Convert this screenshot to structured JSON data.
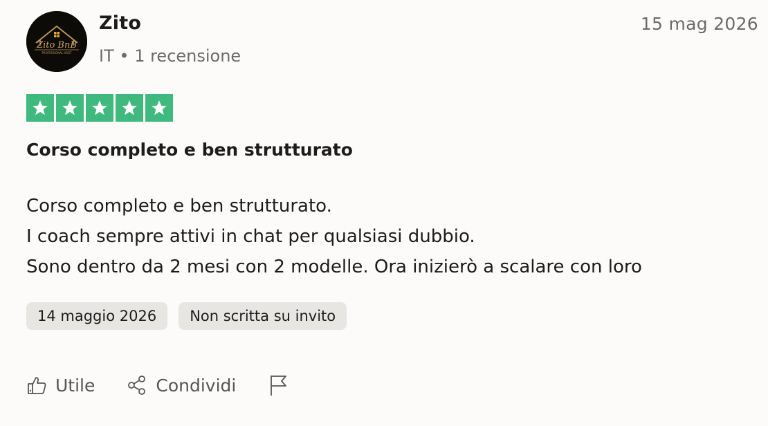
{
  "reviewer": {
    "name": "Zito",
    "country": "IT",
    "separator": "•",
    "review_count": "1 recensione",
    "avatar_icon": "zito-bnb-logo-avatar",
    "avatar_text": "Zito BnB",
    "avatar_subtext": "PROFESSIONAL HOST"
  },
  "review": {
    "date_short": "15 mag 2026",
    "rating": 5,
    "rating_max": 5,
    "star_color": "#3fb97e",
    "title": "Corso completo e ben strutturato",
    "body": [
      "Corso completo e ben strutturato.",
      "I coach sempre attivi in chat per qualsiasi dubbio.",
      "Sono dentro da 2 mesi con 2 modelle. Ora inizierò a scalare con loro"
    ],
    "experience_date": "14 maggio 2026",
    "invite_status": "Non scritta su invito"
  },
  "actions": {
    "useful_label": "Utile",
    "share_label": "Condividi",
    "useful_icon": "thumbs-up-icon",
    "share_icon": "share-icon",
    "report_icon": "flag-icon"
  }
}
